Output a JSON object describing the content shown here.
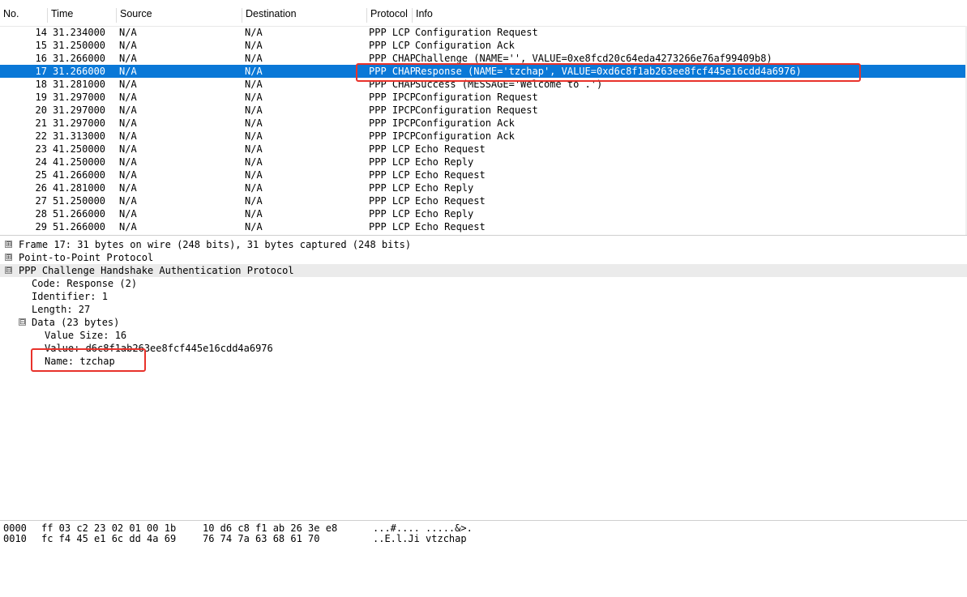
{
  "columns": {
    "no": "No.",
    "time": "Time",
    "source": "Source",
    "destination": "Destination",
    "protocol": "Protocol",
    "info": "Info"
  },
  "packets": [
    {
      "no": "14",
      "time": "31.234000",
      "source": "N/A",
      "destination": "N/A",
      "protocol": "PPP LCP",
      "info": "Configuration Request"
    },
    {
      "no": "15",
      "time": "31.250000",
      "source": "N/A",
      "destination": "N/A",
      "protocol": "PPP LCP",
      "info": "Configuration Ack"
    },
    {
      "no": "16",
      "time": "31.266000",
      "source": "N/A",
      "destination": "N/A",
      "protocol": "PPP CHAP",
      "info": "Challenge (NAME='', VALUE=0xe8fcd20c64eda4273266e76af99409b8)"
    },
    {
      "no": "17",
      "time": "31.266000",
      "source": "N/A",
      "destination": "N/A",
      "protocol": "PPP CHAP",
      "info": "Response (NAME='tzchap', VALUE=0xd6c8f1ab263ee8fcf445e16cdd4a6976)"
    },
    {
      "no": "18",
      "time": "31.281000",
      "source": "N/A",
      "destination": "N/A",
      "protocol": "PPP CHAP",
      "info": "Success (MESSAGE='Welcome to .')"
    },
    {
      "no": "19",
      "time": "31.297000",
      "source": "N/A",
      "destination": "N/A",
      "protocol": "PPP IPCP",
      "info": "Configuration Request"
    },
    {
      "no": "20",
      "time": "31.297000",
      "source": "N/A",
      "destination": "N/A",
      "protocol": "PPP IPCP",
      "info": "Configuration Request"
    },
    {
      "no": "21",
      "time": "31.297000",
      "source": "N/A",
      "destination": "N/A",
      "protocol": "PPP IPCP",
      "info": "Configuration Ack"
    },
    {
      "no": "22",
      "time": "31.313000",
      "source": "N/A",
      "destination": "N/A",
      "protocol": "PPP IPCP",
      "info": "Configuration Ack"
    },
    {
      "no": "23",
      "time": "41.250000",
      "source": "N/A",
      "destination": "N/A",
      "protocol": "PPP LCP",
      "info": "Echo Request"
    },
    {
      "no": "24",
      "time": "41.250000",
      "source": "N/A",
      "destination": "N/A",
      "protocol": "PPP LCP",
      "info": "Echo Reply"
    },
    {
      "no": "25",
      "time": "41.266000",
      "source": "N/A",
      "destination": "N/A",
      "protocol": "PPP LCP",
      "info": "Echo Request"
    },
    {
      "no": "26",
      "time": "41.281000",
      "source": "N/A",
      "destination": "N/A",
      "protocol": "PPP LCP",
      "info": "Echo Reply"
    },
    {
      "no": "27",
      "time": "51.250000",
      "source": "N/A",
      "destination": "N/A",
      "protocol": "PPP LCP",
      "info": "Echo Request"
    },
    {
      "no": "28",
      "time": "51.266000",
      "source": "N/A",
      "destination": "N/A",
      "protocol": "PPP LCP",
      "info": "Echo Reply"
    },
    {
      "no": "29",
      "time": "51.266000",
      "source": "N/A",
      "destination": "N/A",
      "protocol": "PPP LCP",
      "info": "Echo Request"
    }
  ],
  "selected_packet": "17",
  "details": {
    "frame": "Frame 17: 31 bytes on wire (248 bits), 31 bytes captured (248 bits)",
    "ppp": "Point-to-Point Protocol",
    "chap": "PPP Challenge Handshake Authentication Protocol",
    "code": "Code: Response (2)",
    "identifier": "Identifier: 1",
    "length": "Length: 27",
    "data": "Data (23 bytes)",
    "value_size": "Value Size: 16",
    "value": "Value: d6c8f1ab263ee8fcf445e16cdd4a6976",
    "name": "Name: tzchap",
    "expand_symbol": "⊞",
    "collapse_symbol": "⊟"
  },
  "hex": [
    {
      "offset": "0000",
      "bytes1": "ff 03 c2 23 02 01 00 1b",
      "bytes2": "10 d6 c8 f1 ab 26 3e e8",
      "ascii": "...#.... .....&>."
    },
    {
      "offset": "0010",
      "bytes1": "fc f4 45 e1 6c dd 4a 69",
      "bytes2": "76 74 7a 63 68 61 70",
      "ascii": "..E.l.Ji vtzchap"
    }
  ],
  "colors": {
    "selection": "#0a78d7",
    "annotation_red": "#e8322b",
    "section_highlight": "#ebebeb"
  }
}
